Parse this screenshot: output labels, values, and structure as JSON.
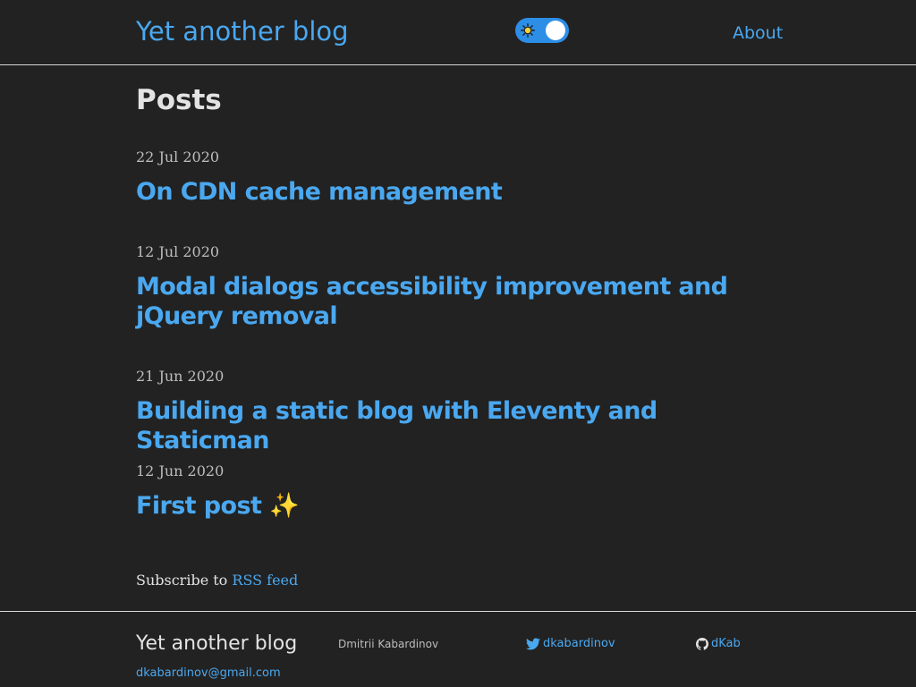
{
  "header": {
    "site_title": "Yet another blog",
    "nav_about": "About",
    "theme_toggle": {
      "state": "light-mode-icon-shown",
      "icon": "sun-icon"
    }
  },
  "main": {
    "heading": "Posts",
    "posts": [
      {
        "date": "22 Jul 2020",
        "title": "On CDN cache management"
      },
      {
        "date": "12 Jul 2020",
        "title": "Modal dialogs accessibility improvement and jQuery removal"
      },
      {
        "date": "21 Jun 2020",
        "title": "Building a static blog with Eleventy and Staticman"
      },
      {
        "date": "12 Jun 2020",
        "title": "First post ✨"
      }
    ],
    "subscribe": {
      "prefix": "Subscribe to ",
      "link": "RSS feed"
    }
  },
  "footer": {
    "site_title": "Yet another blog",
    "author": "Dmitrii Kabardinov",
    "twitter": "dkabardinov",
    "github": "dKab",
    "email": "dkabardinov@gmail.com"
  },
  "colors": {
    "background": "#222222",
    "accent": "#4aa8f0",
    "text": "#e3e3e3",
    "muted": "#bdbdbd",
    "toggle": "#2d8ee6"
  }
}
